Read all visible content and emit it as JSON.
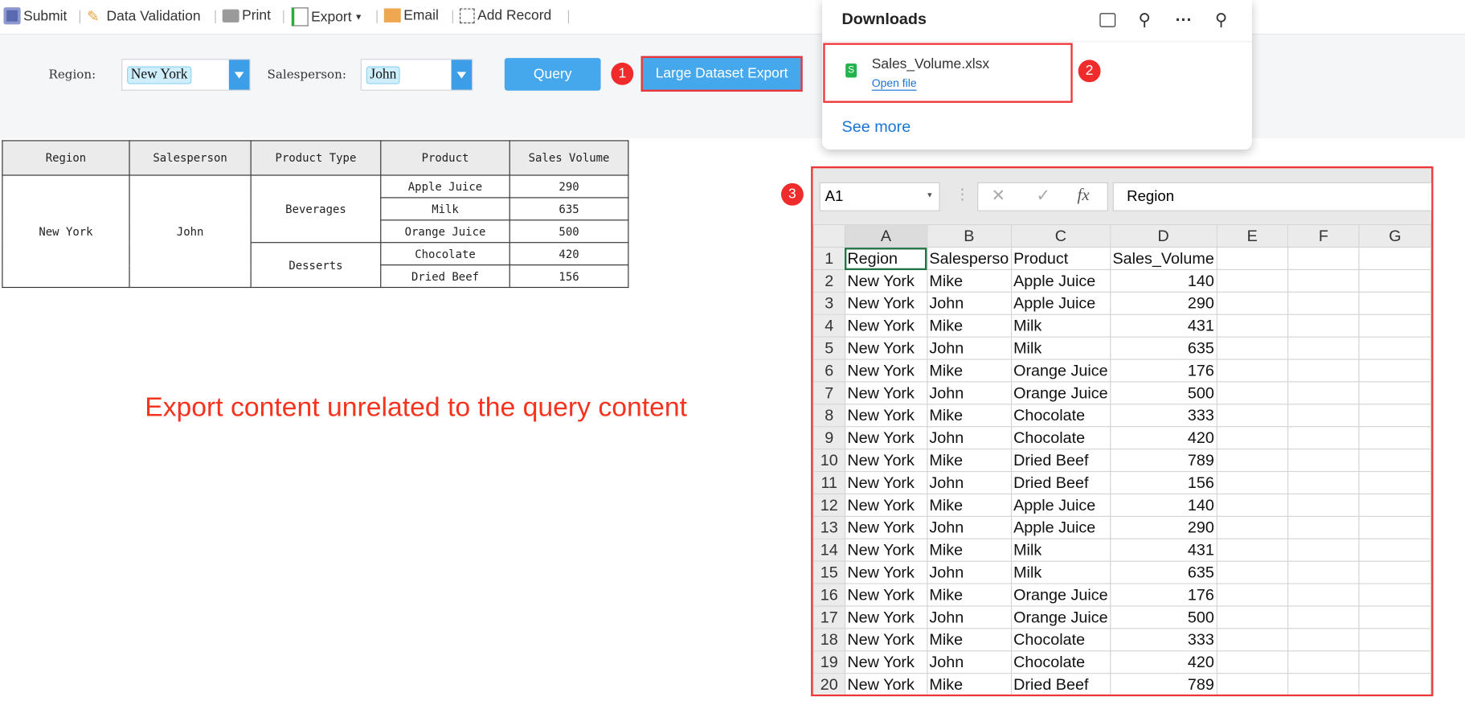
{
  "toolbar": {
    "submit": "Submit",
    "data_validation": "Data Validation",
    "print": "Print",
    "export": "Export",
    "email": "Email",
    "add_record": "Add Record"
  },
  "filter": {
    "region_label": "Region:",
    "region_value": "New York",
    "salesperson_label": "Salesperson:",
    "salesperson_value": "John",
    "query": "Query",
    "large_export": "Large Dataset Export"
  },
  "badges": [
    "1",
    "2",
    "3"
  ],
  "report": {
    "headers": [
      "Region",
      "Salesperson",
      "Product Type",
      "Product",
      "Sales Volume"
    ],
    "region": "New York",
    "salesperson": "John",
    "groups": [
      {
        "type": "Beverages",
        "items": [
          [
            "Apple Juice",
            "290"
          ],
          [
            "Milk",
            "635"
          ],
          [
            "Orange Juice",
            "500"
          ]
        ]
      },
      {
        "type": "Desserts",
        "items": [
          [
            "Chocolate",
            "420"
          ],
          [
            "Dried Beef",
            "156"
          ]
        ]
      }
    ]
  },
  "note": "Export content unrelated to the query content",
  "downloads": {
    "title": "Downloads",
    "file": "Sales_Volume.xlsx",
    "open": "Open file",
    "see_more": "See more",
    "icons": [
      "folder-icon",
      "search-icon",
      "more-icon",
      "pin-icon"
    ]
  },
  "excel": {
    "name_box": "A1",
    "formula": "Region",
    "columns": [
      "A",
      "B",
      "C",
      "D",
      "E",
      "F",
      "G"
    ],
    "rows": [
      [
        "Region",
        "Salesperso",
        "Product",
        "Sales_Volume"
      ],
      [
        "New York",
        "Mike",
        "Apple Juice",
        "140"
      ],
      [
        "New York",
        "John",
        "Apple Juice",
        "290"
      ],
      [
        "New York",
        "Mike",
        "Milk",
        "431"
      ],
      [
        "New York",
        "John",
        "Milk",
        "635"
      ],
      [
        "New York",
        "Mike",
        "Orange Juice",
        "176"
      ],
      [
        "New York",
        "John",
        "Orange Juice",
        "500"
      ],
      [
        "New York",
        "Mike",
        "Chocolate",
        "333"
      ],
      [
        "New York",
        "John",
        "Chocolate",
        "420"
      ],
      [
        "New York",
        "Mike",
        "Dried Beef",
        "789"
      ],
      [
        "New York",
        "John",
        "Dried Beef",
        "156"
      ],
      [
        "New York",
        "Mike",
        "Apple Juice",
        "140"
      ],
      [
        "New York",
        "John",
        "Apple Juice",
        "290"
      ],
      [
        "New York",
        "Mike",
        "Milk",
        "431"
      ],
      [
        "New York",
        "John",
        "Milk",
        "635"
      ],
      [
        "New York",
        "Mike",
        "Orange Juice",
        "176"
      ],
      [
        "New York",
        "John",
        "Orange Juice",
        "500"
      ],
      [
        "New York",
        "Mike",
        "Chocolate",
        "333"
      ],
      [
        "New York",
        "John",
        "Chocolate",
        "420"
      ],
      [
        "New York",
        "Mike",
        "Dried Beef",
        "789"
      ]
    ]
  },
  "colors": {
    "accent": "#46a8ec",
    "highlight": "#ef3535",
    "note": "#f5331e"
  }
}
